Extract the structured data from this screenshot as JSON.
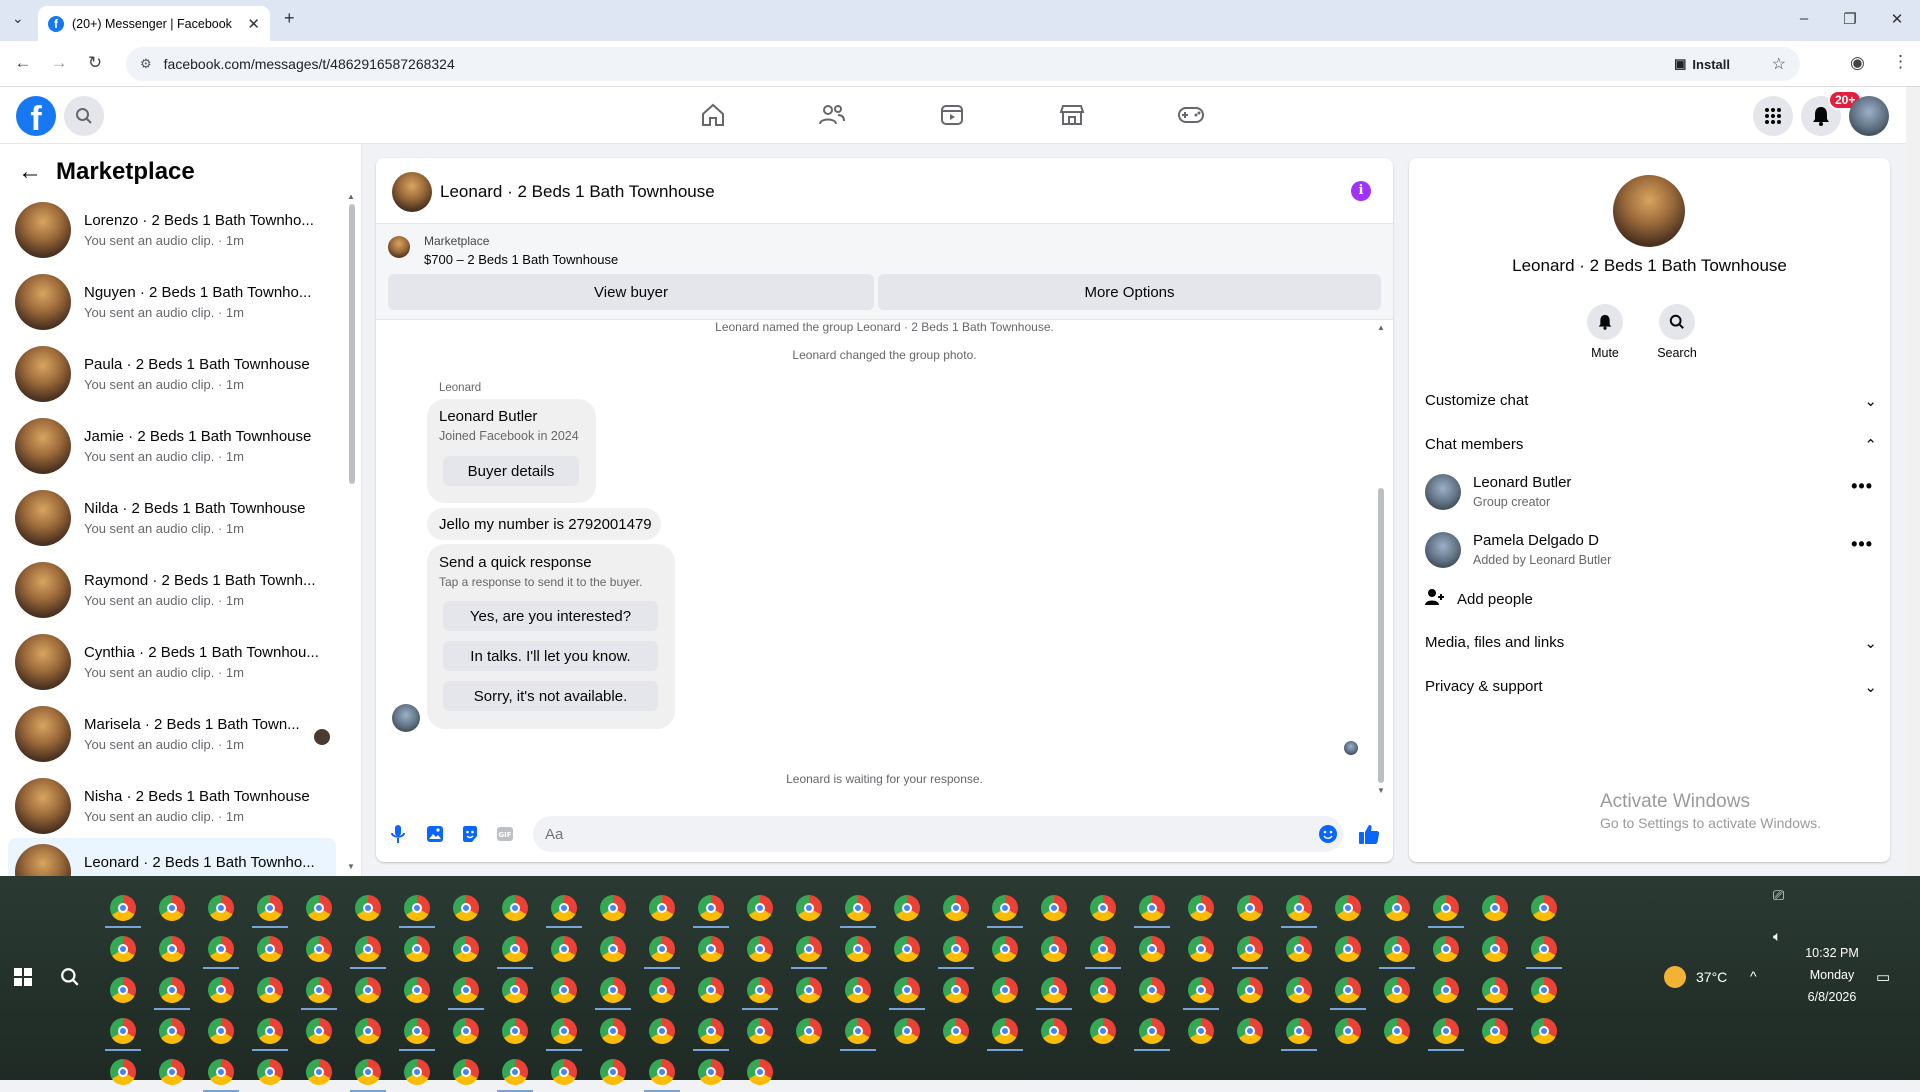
{
  "browser": {
    "tab_title": "(20+) Messenger | Facebook",
    "url": "facebook.com/messages/t/4862916587268324",
    "install_label": "Install"
  },
  "header": {
    "notification_badge": "20+"
  },
  "sidebar": {
    "title": "Marketplace",
    "conversations": [
      {
        "name": "Lorenzo · 2 Beds 1 Bath Townho...",
        "sub": "You sent an audio clip. · 1m"
      },
      {
        "name": "Nguyen · 2 Beds 1 Bath Townho...",
        "sub": "You sent an audio clip. · 1m"
      },
      {
        "name": "Paula · 2 Beds 1 Bath Townhouse",
        "sub": "You sent an audio clip. · 1m"
      },
      {
        "name": "Jamie · 2 Beds 1 Bath Townhouse",
        "sub": "You sent an audio clip. · 1m"
      },
      {
        "name": "Nilda · 2 Beds 1 Bath Townhouse",
        "sub": "You sent an audio clip. · 1m"
      },
      {
        "name": "Raymond · 2 Beds 1 Bath Townh...",
        "sub": "You sent an audio clip. · 1m"
      },
      {
        "name": "Cynthia · 2 Beds 1 Bath Townhou...",
        "sub": "You sent an audio clip. · 1m"
      },
      {
        "name": "Marisela · 2 Beds 1 Bath Town...",
        "sub": "You sent an audio clip. · 1m"
      },
      {
        "name": "Nisha · 2 Beds 1 Bath Townhouse",
        "sub": "You sent an audio clip. · 1m"
      },
      {
        "name": "Leonard · 2 Beds 1 Bath Townho...",
        "sub": ""
      }
    ]
  },
  "chat": {
    "title": "Leonard · 2 Beds 1 Bath Townhouse",
    "listing_label": "Marketplace",
    "listing_title": "$700 – 2 Beds 1 Bath Townhouse",
    "view_buyer": "View buyer",
    "more_options": "More Options",
    "sys_named": "Leonard named the group Leonard · 2 Beds 1 Bath Townhouse.",
    "sys_photo": "Leonard changed the group photo.",
    "sender": "Leonard",
    "card_name": "Leonard Butler",
    "card_sub": "Joined Facebook in 2024",
    "buyer_details": "Buyer details",
    "message": "Jello my number is 2792001479",
    "qr_title": "Send a quick response",
    "qr_sub": "Tap a response to send it to the buyer.",
    "quick_replies": [
      "Yes, are you interested?",
      "In talks. I'll let you know.",
      "Sorry, it's not available."
    ],
    "waiting": "Leonard is waiting for your response.",
    "input_placeholder": "Aa"
  },
  "details": {
    "title": "Leonard · 2 Beds 1 Bath Townhouse",
    "mute": "Mute",
    "search": "Search",
    "customize": "Customize chat",
    "members_title": "Chat members",
    "members": [
      {
        "name": "Leonard Butler",
        "sub": "Group creator"
      },
      {
        "name": "Pamela Delgado D",
        "sub": "Added by Leonard Butler"
      }
    ],
    "add_people": "Add people",
    "media": "Media, files and links",
    "privacy": "Privacy & support"
  },
  "watermark": {
    "line1": "Activate Windows",
    "line2": "Go to Settings to activate Windows."
  },
  "tray": {
    "temp": "37°C",
    "time": "10:32 PM",
    "day": "Monday",
    "date": "6/8/2026"
  },
  "colors": {
    "fb_blue": "#1877f2",
    "messenger_blue": "#0866ff",
    "info_purple": "#a033ff",
    "badge_red": "#e41e3f"
  }
}
